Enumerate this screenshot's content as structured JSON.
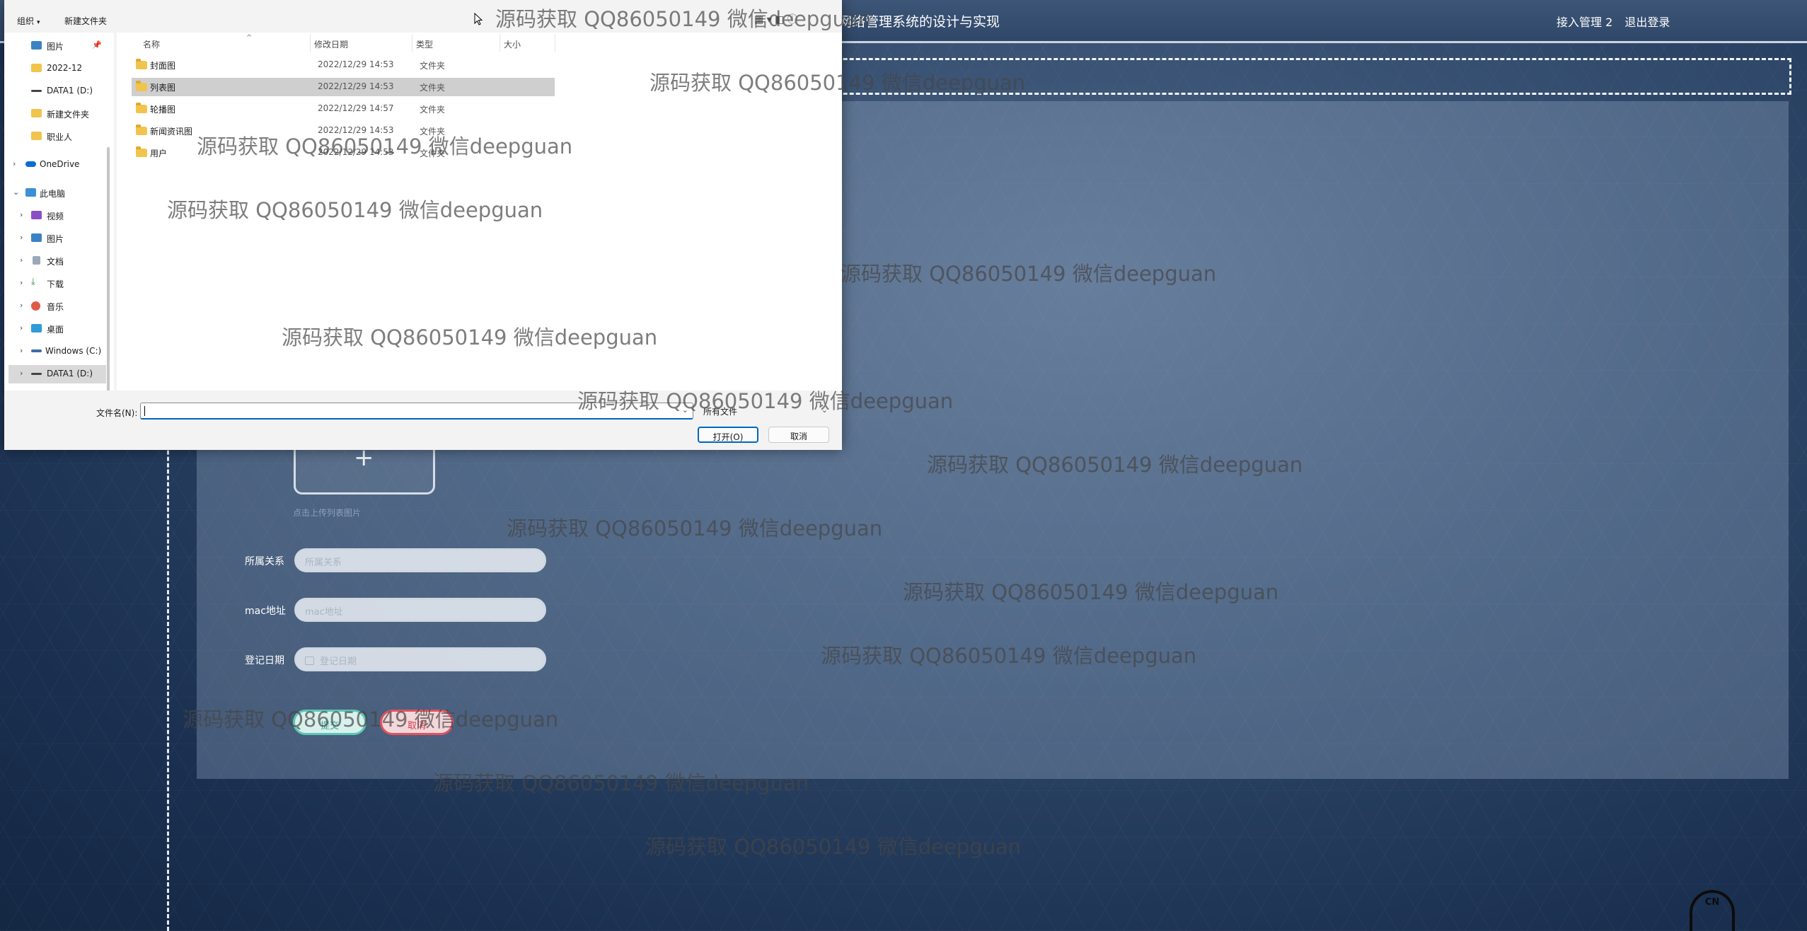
{
  "app": {
    "title": "网络管理系统的设计与实现",
    "user_label": "接入管理 2",
    "logout_label": "退出登录"
  },
  "form": {
    "upload_hint": "点击上传列表图片",
    "fields": [
      {
        "label": "所属关系",
        "placeholder": "所属关系"
      },
      {
        "label": "mac地址",
        "placeholder": "mac地址"
      },
      {
        "label": "登记日期",
        "placeholder": "登记日期"
      }
    ],
    "submit_label": "提交",
    "cancel_label": "取消"
  },
  "corner_logo_text": "CN",
  "dialog": {
    "toolbar": {
      "organize": "组织",
      "new_folder": "新建文件夹"
    },
    "nav": [
      {
        "label": "图片",
        "icon": "pictures-icon",
        "pinned": true
      },
      {
        "label": "2022-12",
        "icon": "folder-icon"
      },
      {
        "label": "DATA1 (D:)",
        "icon": "drive-icon"
      },
      {
        "label": "新建文件夹",
        "icon": "folder-icon"
      },
      {
        "label": "职业人",
        "icon": "folder-icon"
      },
      {
        "label": "OneDrive",
        "icon": "cloud-icon"
      },
      {
        "label": "此电脑",
        "icon": "computer-icon"
      },
      {
        "label": "视频",
        "icon": "videos-icon"
      },
      {
        "label": "图片",
        "icon": "pictures-icon"
      },
      {
        "label": "文档",
        "icon": "documents-icon"
      },
      {
        "label": "下载",
        "icon": "downloads-icon"
      },
      {
        "label": "音乐",
        "icon": "music-icon"
      },
      {
        "label": "桌面",
        "icon": "desktop-icon"
      },
      {
        "label": "Windows (C:)",
        "icon": "drive-icon"
      },
      {
        "label": "DATA1 (D:)",
        "icon": "drive-icon"
      }
    ],
    "columns": {
      "name": "名称",
      "modified": "修改日期",
      "type": "类型",
      "size": "大小"
    },
    "files": [
      {
        "name": "封面图",
        "modified": "2022/12/29 14:53",
        "type": "文件夹"
      },
      {
        "name": "列表图",
        "modified": "2022/12/29 14:53",
        "type": "文件夹"
      },
      {
        "name": "轮播图",
        "modified": "2022/12/29 14:57",
        "type": "文件夹"
      },
      {
        "name": "新闻资讯图",
        "modified": "2022/12/29 14:53",
        "type": "文件夹"
      },
      {
        "name": "用户",
        "modified": "2022/12/29 14:53",
        "type": "文件夹"
      }
    ],
    "filename_label": "文件名(N):",
    "filename_value": "",
    "file_type": "所有文件",
    "open_label": "打开(O)",
    "cancel_label": "取消"
  },
  "watermark_text": "源码获取 QQ86050149 微信deepguan"
}
